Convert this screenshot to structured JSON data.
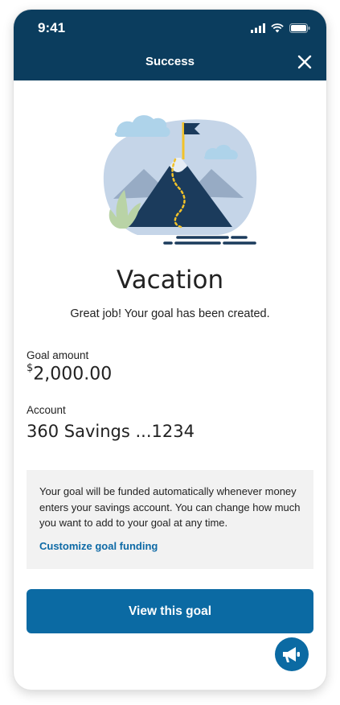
{
  "status_bar": {
    "time": "9:41"
  },
  "header": {
    "title": "Success"
  },
  "goal": {
    "name": "Vacation",
    "message": "Great job! Your goal has been created.",
    "amount_label": "Goal amount",
    "currency_symbol": "$",
    "amount_value": "2,000.00",
    "account_label": "Account",
    "account_value": "360 Savings ...1234"
  },
  "info_card": {
    "text": "Your goal will be funded automatically whenever money enters your savings account. You can change how much you want to add to your goal at any time.",
    "link_label": "Customize goal funding"
  },
  "cta": {
    "label": "View this goal"
  },
  "icons": {
    "close": "close-icon",
    "feedback": "megaphone-icon",
    "signal": "signal-icon",
    "wifi": "wifi-icon",
    "battery": "battery-icon"
  },
  "colors": {
    "header_bg": "#0b3d5e",
    "primary": "#0b6aa3",
    "link": "#0e6aa6",
    "card_bg": "#f2f2f2"
  }
}
